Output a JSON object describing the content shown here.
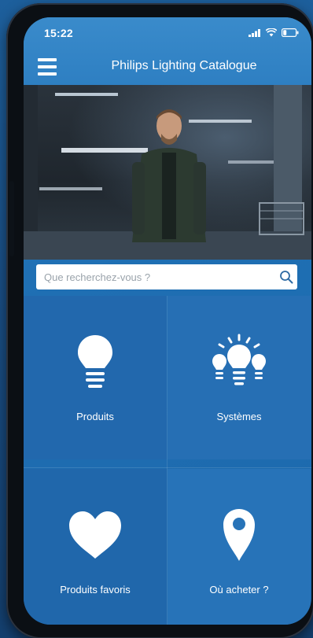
{
  "status_bar": {
    "time": "15:22",
    "icons": [
      "signal-icon",
      "wifi-icon",
      "battery-icon"
    ]
  },
  "header": {
    "title": "Philips Lighting Catalogue",
    "menu_icon": "hamburger-menu-icon"
  },
  "search": {
    "placeholder": "Que recherchez-vous ?",
    "icon": "search-icon"
  },
  "tiles": [
    {
      "label": "Produits",
      "icon": "light-bulb-icon"
    },
    {
      "label": "Systèmes",
      "icon": "light-bulbs-system-icon"
    },
    {
      "label": "Produits favoris",
      "icon": "heart-icon"
    },
    {
      "label": "Où acheter ?",
      "icon": "location-pin-icon"
    }
  ],
  "colors": {
    "brand_blue": "#2e7fc2",
    "tile_blue": "#2268ad",
    "text": "#ffffff"
  }
}
